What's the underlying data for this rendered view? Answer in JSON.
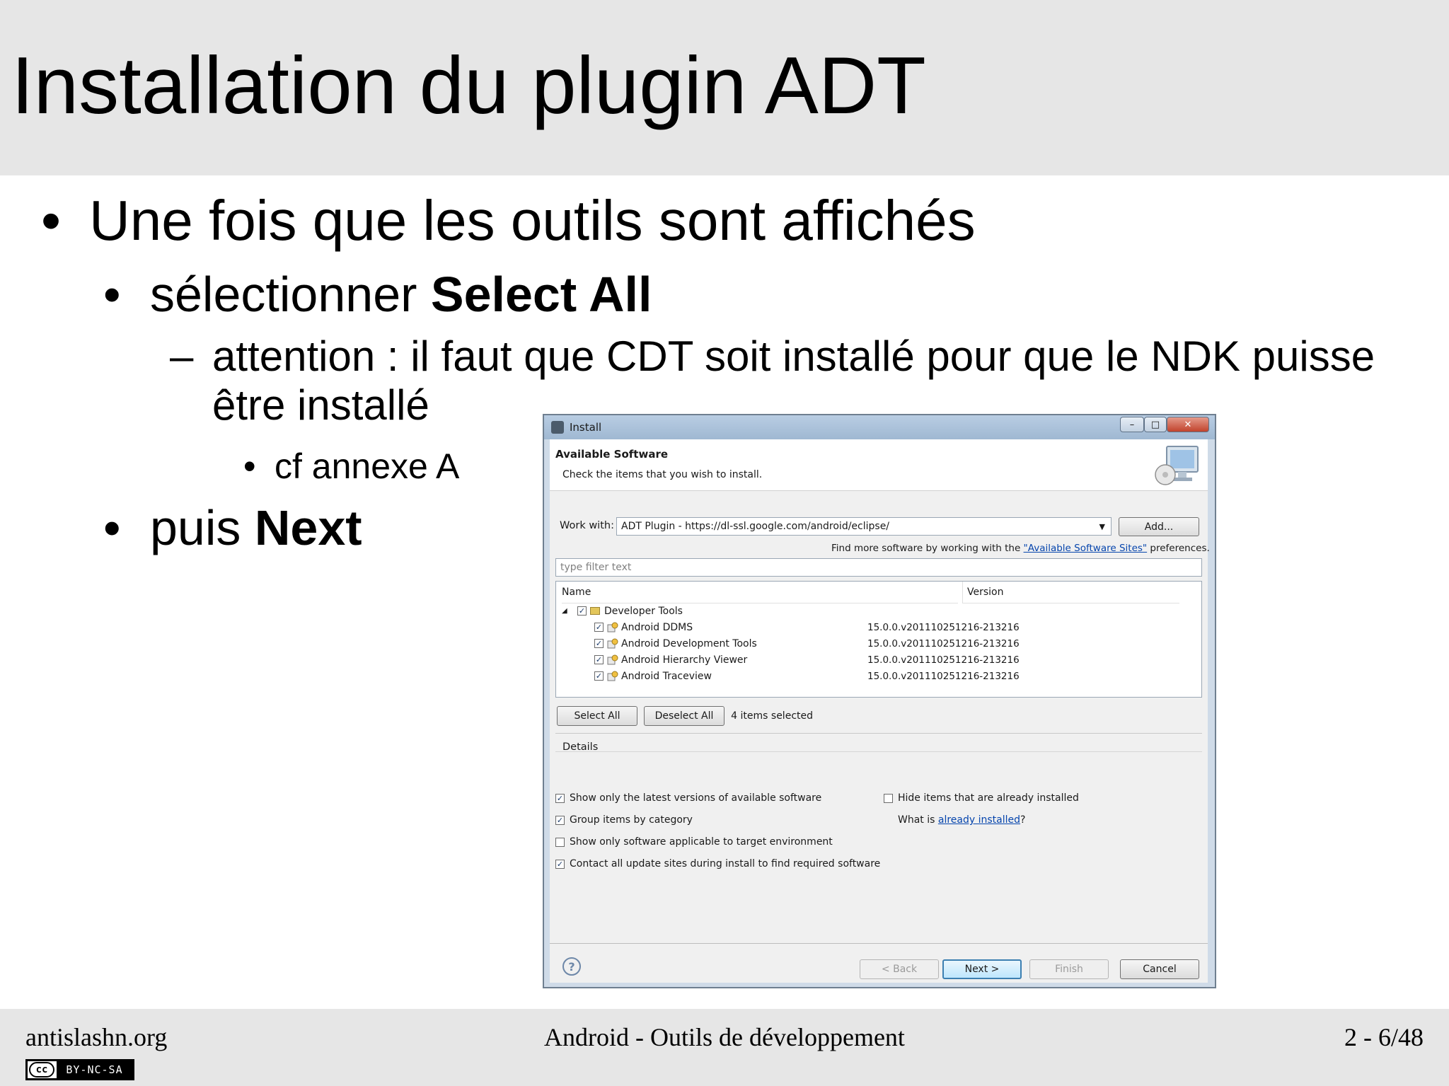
{
  "slide": {
    "title": "Installation du plugin ADT",
    "bullets": {
      "b1": "Une fois que les outils sont affichés",
      "b2_prefix": "sélectionner ",
      "b2_bold": "Select All",
      "b3_line1": "attention : il faut que CDT soit installé pour que le NDK puisse",
      "b3_line2": "être installé",
      "b4": "cf annexe A",
      "b5_prefix": "puis ",
      "b5_bold": "Next"
    },
    "marks": {
      "dot": "•",
      "dash": "–"
    }
  },
  "footer": {
    "left": "antislashn.org",
    "center": "Android - Outils de développement",
    "right": "2 - 6/48",
    "cc_symbol": "cc",
    "cc_text": "BY-NC-SA"
  },
  "dialog": {
    "title": "Install",
    "header_title": "Available Software",
    "header_subtitle": "Check the items that you wish to install.",
    "work_with_label": "Work with:",
    "work_with_value": "ADT Plugin - https://dl-ssl.google.com/android/eclipse/",
    "add_button": "Add...",
    "find_more_prefix": "Find more software by working with the ",
    "find_more_link": "\"Available Software Sites\"",
    "find_more_suffix": " preferences.",
    "filter_placeholder": "type filter text",
    "columns": {
      "name": "Name",
      "version": "Version"
    },
    "category": "Developer Tools",
    "items": [
      {
        "name": "Android DDMS",
        "version": "15.0.0.v201110251216-213216"
      },
      {
        "name": "Android Development Tools",
        "version": "15.0.0.v201110251216-213216"
      },
      {
        "name": "Android Hierarchy Viewer",
        "version": "15.0.0.v201110251216-213216"
      },
      {
        "name": "Android Traceview",
        "version": "15.0.0.v201110251216-213216"
      }
    ],
    "select_all": "Select All",
    "deselect_all": "Deselect All",
    "items_selected": "4 items selected",
    "details_label": "Details",
    "options": {
      "latest_versions": "Show only the latest versions of available software",
      "group_by_category": "Group items by category",
      "applicable_only": "Show only software applicable to target environment",
      "contact_sites": "Contact all update sites during install to find required software",
      "hide_installed": "Hide items that are already installed",
      "what_is_prefix": "What is ",
      "what_is_link": "already installed",
      "what_is_suffix": "?"
    },
    "buttons": {
      "back": "< Back",
      "next": "Next >",
      "finish": "Finish",
      "cancel": "Cancel"
    },
    "window_controls": {
      "minimize": "–",
      "maximize": "□",
      "close": "✕"
    },
    "check": "✓",
    "tree_toggle": "◢",
    "combo_arrow": "▼",
    "help": "?"
  }
}
